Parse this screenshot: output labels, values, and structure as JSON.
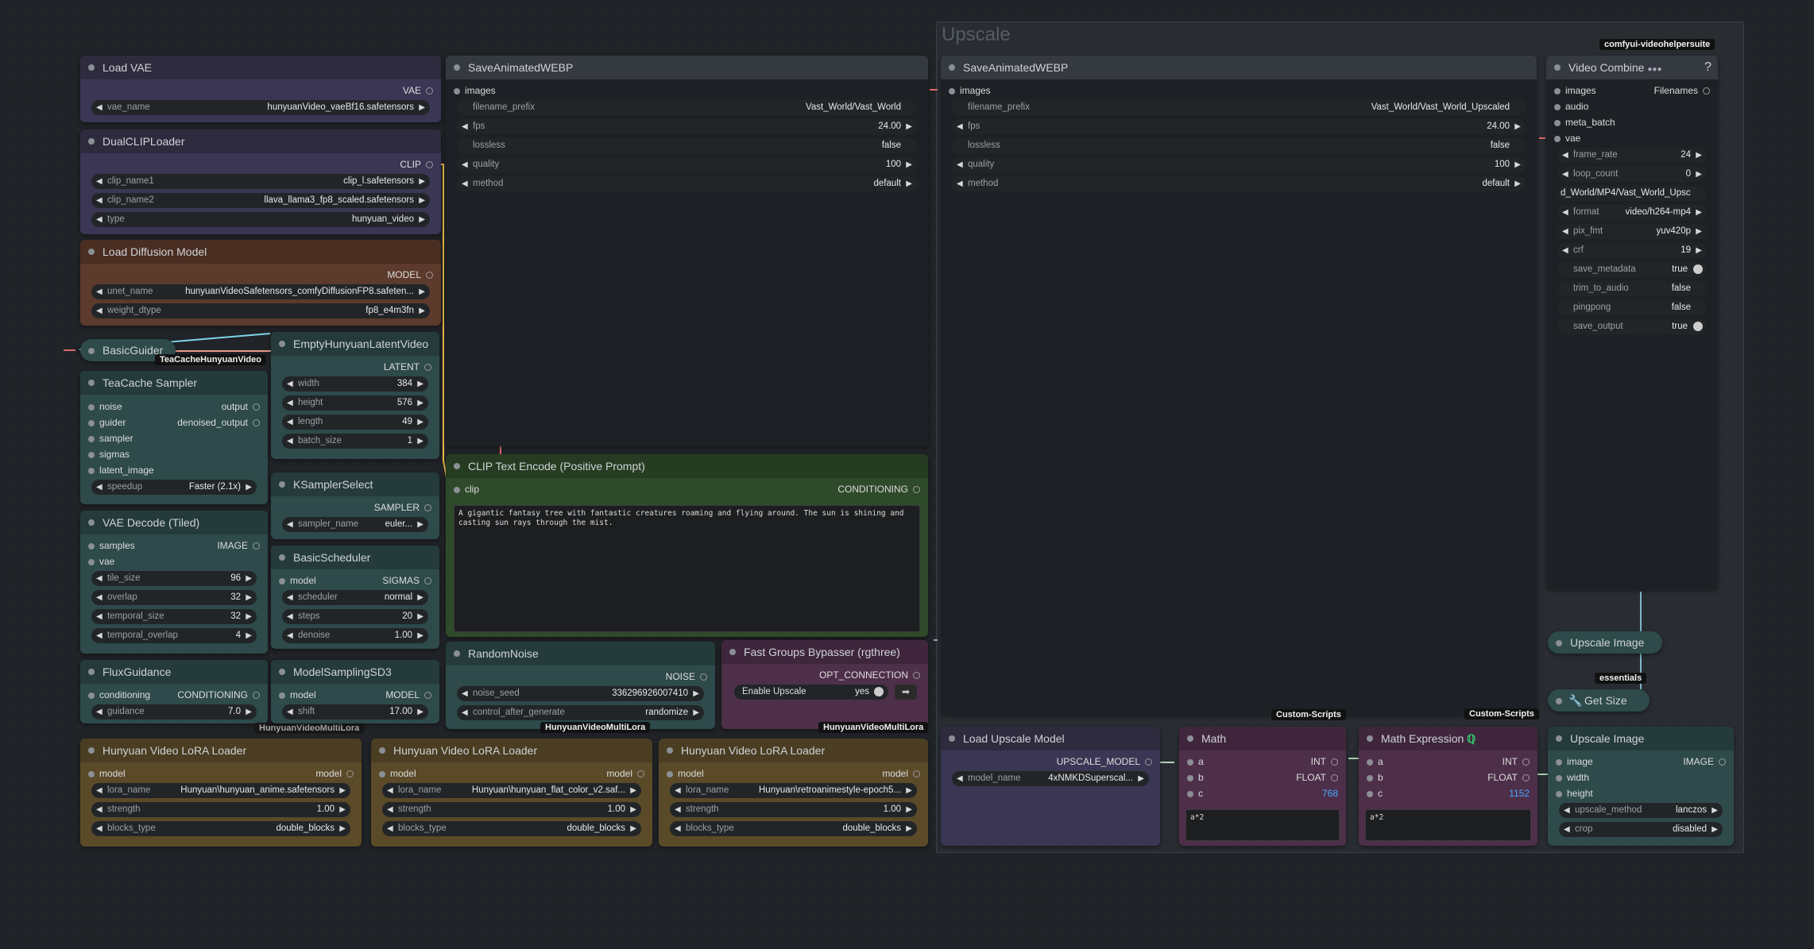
{
  "upscale_group": {
    "title": "Upscale"
  },
  "nodes": {
    "load_vae": {
      "title": "Load VAE",
      "out": "VAE",
      "vae_name": {
        "label": "vae_name",
        "value": "hunyuanVideo_vaeBf16.safetensors"
      }
    },
    "dual_clip": {
      "title": "DualCLIPLoader",
      "out": "CLIP",
      "clip_name1": {
        "label": "clip_name1",
        "value": "clip_l.safetensors"
      },
      "clip_name2": {
        "label": "clip_name2",
        "value": "llava_llama3_fp8_scaled.safetensors"
      },
      "type": {
        "label": "type",
        "value": "hunyuan_video"
      }
    },
    "load_diffusion": {
      "title": "Load Diffusion Model",
      "out": "MODEL",
      "unet_name": {
        "label": "unet_name",
        "value": "hunyuanVideoSafetensors_comfyDiffusionFP8.safeten..."
      },
      "weight_dtype": {
        "label": "weight_dtype",
        "value": "fp8_e4m3fn"
      }
    },
    "basic_guider": {
      "title": "BasicGuider",
      "badge": "TeaCacheHunyuanVideo"
    },
    "teacache": {
      "title": "TeaCache Sampler",
      "inputs": [
        "noise",
        "guider",
        "sampler",
        "sigmas",
        "latent_image"
      ],
      "outputs": [
        "output",
        "denoised_output"
      ],
      "speedup": {
        "label": "speedup",
        "value": "Faster (2.1x)"
      }
    },
    "empty_latent": {
      "title": "EmptyHunyuanLatentVideo",
      "out": "LATENT",
      "width": {
        "label": "width",
        "value": "384"
      },
      "height": {
        "label": "height",
        "value": "576"
      },
      "length": {
        "label": "length",
        "value": "49"
      },
      "batch_size": {
        "label": "batch_size",
        "value": "1"
      }
    },
    "ksampler_select": {
      "title": "KSamplerSelect",
      "out": "SAMPLER",
      "sampler_name": {
        "label": "sampler_name",
        "value": "euler..."
      }
    },
    "vae_decode": {
      "title": "VAE Decode (Tiled)",
      "inputs": [
        "samples",
        "vae"
      ],
      "out": "IMAGE",
      "tile_size": {
        "label": "tile_size",
        "value": "96"
      },
      "overlap": {
        "label": "overlap",
        "value": "32"
      },
      "temporal_size": {
        "label": "temporal_size",
        "value": "32"
      },
      "temporal_overlap": {
        "label": "temporal_overlap",
        "value": "4"
      }
    },
    "basic_scheduler": {
      "title": "BasicScheduler",
      "in": "model",
      "out": "SIGMAS",
      "scheduler": {
        "label": "scheduler",
        "value": "normal"
      },
      "steps": {
        "label": "steps",
        "value": "20"
      },
      "denoise": {
        "label": "denoise",
        "value": "1.00"
      }
    },
    "flux_guidance": {
      "title": "FluxGuidance",
      "in": "conditioning",
      "out": "CONDITIONING",
      "guidance": {
        "label": "guidance",
        "value": "7.0"
      },
      "badge": "HunyuanVideoMultiLora"
    },
    "model_sampling": {
      "title": "ModelSamplingSD3",
      "in": "model",
      "out": "MODEL",
      "shift": {
        "label": "shift",
        "value": "17.00"
      }
    },
    "save_webp1": {
      "title": "SaveAnimatedWEBP",
      "in": "images",
      "filename_prefix": {
        "label": "filename_prefix",
        "value": "Vast_World/Vast_World"
      },
      "fps": {
        "label": "fps",
        "value": "24.00"
      },
      "lossless": {
        "label": "lossless",
        "value": "false"
      },
      "quality": {
        "label": "quality",
        "value": "100"
      },
      "method": {
        "label": "method",
        "value": "default"
      }
    },
    "clip_text": {
      "title": "CLIP Text Encode (Positive Prompt)",
      "in": "clip",
      "out": "CONDITIONING",
      "text": "A gigantic fantasy tree with fantastic creatures roaming and flying around. The sun is shining and casting sun rays through the mist."
    },
    "random_noise": {
      "title": "RandomNoise",
      "out": "NOISE",
      "noise_seed": {
        "label": "noise_seed",
        "value": "336296926007410"
      },
      "control": {
        "label": "control_after_generate",
        "value": "randomize"
      },
      "badge": "HunyuanVideoMultiLora"
    },
    "fast_groups": {
      "title": "Fast Groups Bypasser (rgthree)",
      "out": "OPT_CONNECTION",
      "enable": {
        "label": "Enable Upscale",
        "value": "yes"
      },
      "badge": "HunyuanVideoMultiLora"
    },
    "lora1": {
      "title": "Hunyuan Video LoRA Loader",
      "in": "model",
      "out": "model",
      "lora_name": {
        "label": "lora_name",
        "value": "Hunyuan\\hunyuan_anime.safetensors"
      },
      "strength": {
        "label": "strength",
        "value": "1.00"
      },
      "blocks_type": {
        "label": "blocks_type",
        "value": "double_blocks"
      }
    },
    "lora2": {
      "title": "Hunyuan Video LoRA Loader",
      "in": "model",
      "out": "model",
      "lora_name": {
        "label": "lora_name",
        "value": "Hunyuan\\hunyuan_flat_color_v2.saf..."
      },
      "strength": {
        "label": "strength",
        "value": "1.00"
      },
      "blocks_type": {
        "label": "blocks_type",
        "value": "double_blocks"
      }
    },
    "lora3": {
      "title": "Hunyuan Video LoRA Loader",
      "in": "model",
      "out": "model",
      "lora_name": {
        "label": "lora_name",
        "value": "Hunyuan\\retroanimestyle-epoch5..."
      },
      "strength": {
        "label": "strength",
        "value": "1.00"
      },
      "blocks_type": {
        "label": "blocks_type",
        "value": "double_blocks"
      }
    },
    "save_webp2": {
      "title": "SaveAnimatedWEBP",
      "in": "images",
      "filename_prefix": {
        "label": "filename_prefix",
        "value": "Vast_World/Vast_World_Upscaled"
      },
      "fps": {
        "label": "fps",
        "value": "24.00"
      },
      "lossless": {
        "label": "lossless",
        "value": "false"
      },
      "quality": {
        "label": "quality",
        "value": "100"
      },
      "method": {
        "label": "method",
        "value": "default"
      }
    },
    "video_combine": {
      "title": "Video Combine",
      "badge": "comfyui-videohelpersuite",
      "help": "?",
      "inputs": [
        "images",
        "audio",
        "meta_batch",
        "vae"
      ],
      "out": "Filenames",
      "frame_rate": {
        "label": "frame_rate",
        "value": "24"
      },
      "loop_count": {
        "label": "loop_count",
        "value": "0"
      },
      "filename_prefix": {
        "value": "d_World/MP4/Vast_World_Upsc"
      },
      "format": {
        "label": "format",
        "value": "video/h264-mp4"
      },
      "pix_fmt": {
        "label": "pix_fmt",
        "value": "yuv420p"
      },
      "crf": {
        "label": "crf",
        "value": "19"
      },
      "save_metadata": {
        "label": "save_metadata",
        "value": "true"
      },
      "trim_to_audio": {
        "label": "trim_to_audio",
        "value": "false"
      },
      "pingpong": {
        "label": "pingpong",
        "value": "false"
      },
      "save_output": {
        "label": "save_output",
        "value": "true"
      }
    },
    "upscale_image_reroute": {
      "title": "Upscale Image"
    },
    "get_size": {
      "title": "Get Size",
      "badge": "essentials"
    },
    "load_upscale": {
      "title": "Load Upscale Model",
      "out": "UPSCALE_MODEL",
      "model_name": {
        "label": "model_name",
        "value": "4xNMKDSuperscal..."
      }
    },
    "math": {
      "title": "Math",
      "badge": "Custom-Scripts",
      "inputs": [
        "a",
        "b",
        "c"
      ],
      "outputs": [
        "INT",
        "FLOAT"
      ],
      "result": "768",
      "expr": "a*2"
    },
    "math_expr": {
      "title": "Math Expression",
      "badge": "Custom-Scripts",
      "inputs": [
        "a",
        "b",
        "c"
      ],
      "outputs": [
        "INT",
        "FLOAT"
      ],
      "result": "1152",
      "expr": "a*2"
    },
    "upscale_image": {
      "title": "Upscale Image",
      "inputs": [
        "image",
        "width",
        "height"
      ],
      "out": "IMAGE",
      "upscale_method": {
        "label": "upscale_method",
        "value": "lanczos"
      },
      "crop": {
        "label": "crop",
        "value": "disabled"
      }
    }
  },
  "colors": {
    "canvas": "#202327",
    "node_dark": "#353a40",
    "purple": "#3b3654",
    "brown": "#5c3a2c",
    "teal": "#2e4a4a",
    "green": "#2f4a2a",
    "gold": "#5a4a28",
    "magenta": "#4e2f4a"
  }
}
